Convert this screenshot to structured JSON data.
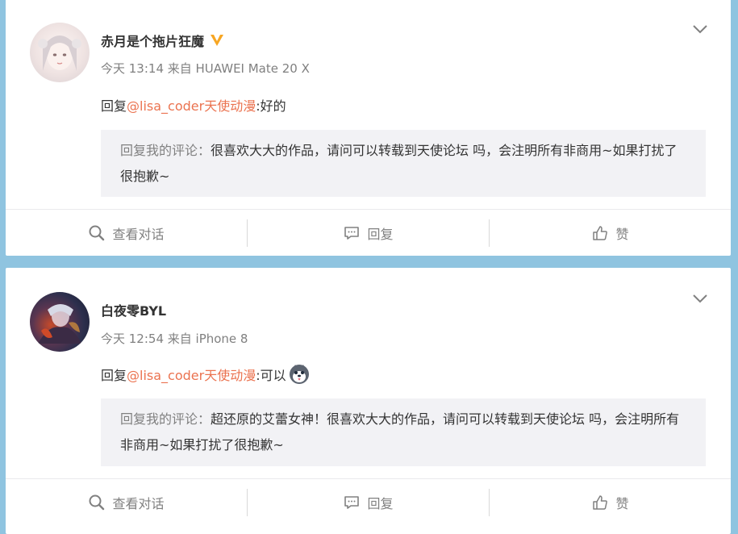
{
  "comments": [
    {
      "username": "赤月是个拖片狂魔",
      "verified": true,
      "time": "今天 13:14 来自 HUAWEI Mate 20 X",
      "reply_prefix": "回复",
      "mention": "@lisa_coder天使动漫",
      "reply_body": ":好的",
      "has_emoji": false,
      "quote_label": "回复我的评论：",
      "quote_text": "很喜欢大大的作品，请问可以转载到天使论坛  吗，会注明所有非商用~如果打扰了很抱歉~"
    },
    {
      "username": "白夜零BYL",
      "verified": false,
      "time": "今天 12:54 来自 iPhone 8",
      "reply_prefix": "回复",
      "mention": "@lisa_coder天使动漫",
      "reply_body": ":可以",
      "has_emoji": true,
      "quote_label": "回复我的评论：",
      "quote_text": "超还原的艾蕾女神！很喜欢大大的作品，请问可以转载到天使论坛  吗，会注明所有非商用~如果打扰了很抱歉~"
    }
  ],
  "actions": {
    "view_conversation": "查看对话",
    "reply": "回复",
    "like": "赞"
  },
  "icons": [
    "search-icon",
    "comment-icon",
    "thumbs-up-icon",
    "chevron-down-icon",
    "verified-v-icon",
    "husky-emoji-icon"
  ],
  "colors": {
    "mention": "#eb7350",
    "verified": "#f7a623",
    "background": "#8fc4e0"
  }
}
